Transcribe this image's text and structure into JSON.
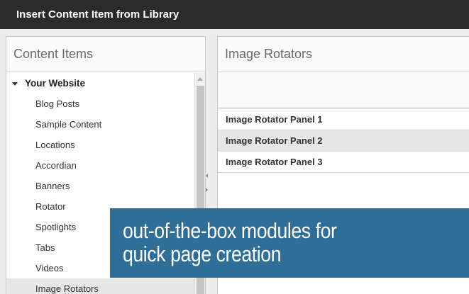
{
  "dialog": {
    "title": "Insert Content Item from Library"
  },
  "left_panel": {
    "header": "Content Items",
    "tree": {
      "root_label": "Your Website",
      "items": [
        {
          "label": "Blog Posts"
        },
        {
          "label": "Sample Content"
        },
        {
          "label": "Locations"
        },
        {
          "label": "Accordian"
        },
        {
          "label": "Banners"
        },
        {
          "label": "Rotator"
        },
        {
          "label": "Spotlights"
        },
        {
          "label": "Tabs"
        },
        {
          "label": "Videos"
        },
        {
          "label": "Image Rotators",
          "selected": true
        }
      ]
    }
  },
  "right_panel": {
    "header": "Image Rotators",
    "rows": [
      {
        "label": "Image Rotator Panel 1"
      },
      {
        "label": "Image Rotator Panel 2",
        "selected": true
      },
      {
        "label": "Image Rotator Panel 3"
      }
    ]
  },
  "caption": {
    "line1": "out-of-the-box modules for",
    "line2": "quick page creation"
  },
  "colors": {
    "titlebar_bg": "#2b2b2b",
    "caption_bg": "#2e6e97",
    "selected_row_bg": "#e6e6e6"
  },
  "icons": {
    "tree_expand": "caret-down-icon",
    "scroll_up": "scroll-up-arrow-icon",
    "splitter_collapse": "chevron-left-icon",
    "splitter_expand": "chevron-right-icon"
  }
}
